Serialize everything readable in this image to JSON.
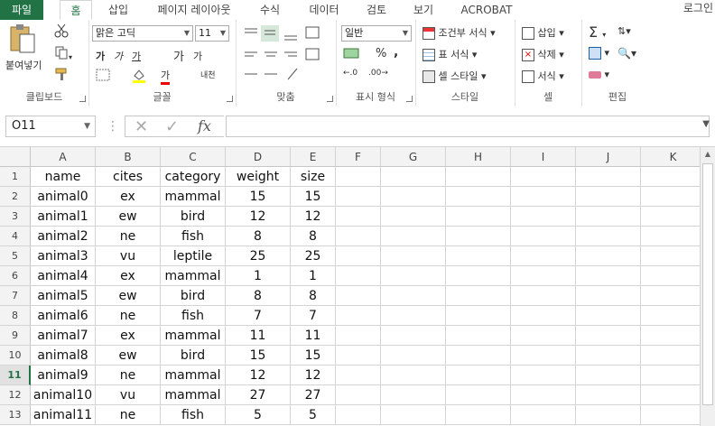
{
  "tabs": {
    "file": "파일",
    "home": "홈",
    "insert": "삽입",
    "layout": "페이지 레이아웃",
    "formulas": "수식",
    "data": "데이터",
    "review": "검토",
    "view": "보기",
    "acrobat": "ACROBAT",
    "login": "로그인"
  },
  "ribbon": {
    "clipboard": {
      "label": "클립보드",
      "paste": "붙여넣기"
    },
    "font": {
      "label": "글꼴",
      "name": "맑은 고딕",
      "size": "11",
      "bold": "가",
      "italic": "가",
      "underline": "가",
      "grow": "가",
      "shrink": "가",
      "color_a": "가",
      "phonetic": "내천"
    },
    "alignment": {
      "label": "맞춤"
    },
    "number": {
      "label": "표시 형식",
      "format": "일반",
      "percent": "%",
      "comma": ","
    },
    "styles": {
      "label": "스타일",
      "conditional": "조건부 서식",
      "table": "표 서식",
      "cell_styles": "셀 스타일"
    },
    "cells": {
      "label": "셀",
      "insert": "삽입",
      "delete": "삭제",
      "format": "서식"
    },
    "editing": {
      "label": "편집"
    }
  },
  "formula_bar": {
    "name_box": "O11",
    "fx": "fx",
    "value": ""
  },
  "columns": [
    "A",
    "B",
    "C",
    "D",
    "E",
    "F",
    "G",
    "H",
    "I",
    "J",
    "K"
  ],
  "rows": [
    "1",
    "2",
    "3",
    "4",
    "5",
    "6",
    "7",
    "8",
    "9",
    "10",
    "11",
    "12",
    "13"
  ],
  "selected_row": "11",
  "cells": [
    [
      "name",
      "cites",
      "category",
      "weight",
      "size"
    ],
    [
      "animal0",
      "ex",
      "mammal",
      "15",
      "15"
    ],
    [
      "animal1",
      "ew",
      "bird",
      "12",
      "12"
    ],
    [
      "animal2",
      "ne",
      "fish",
      "8",
      "8"
    ],
    [
      "animal3",
      "vu",
      "leptile",
      "25",
      "25"
    ],
    [
      "animal4",
      "ex",
      "mammal",
      "1",
      "1"
    ],
    [
      "animal5",
      "ew",
      "bird",
      "8",
      "8"
    ],
    [
      "animal6",
      "ne",
      "fish",
      "7",
      "7"
    ],
    [
      "animal7",
      "ex",
      "mammal",
      "11",
      "11"
    ],
    [
      "animal8",
      "ew",
      "bird",
      "15",
      "15"
    ],
    [
      "animal9",
      "ne",
      "mammal",
      "12",
      "12"
    ],
    [
      "animal10",
      "vu",
      "mammal",
      "27",
      "27"
    ],
    [
      "animal11",
      "ne",
      "fish",
      "5",
      "5"
    ]
  ],
  "colors": {
    "accent": "#217346",
    "header_bg": "#f3f3f3",
    "grid": "#d4d4d4"
  }
}
